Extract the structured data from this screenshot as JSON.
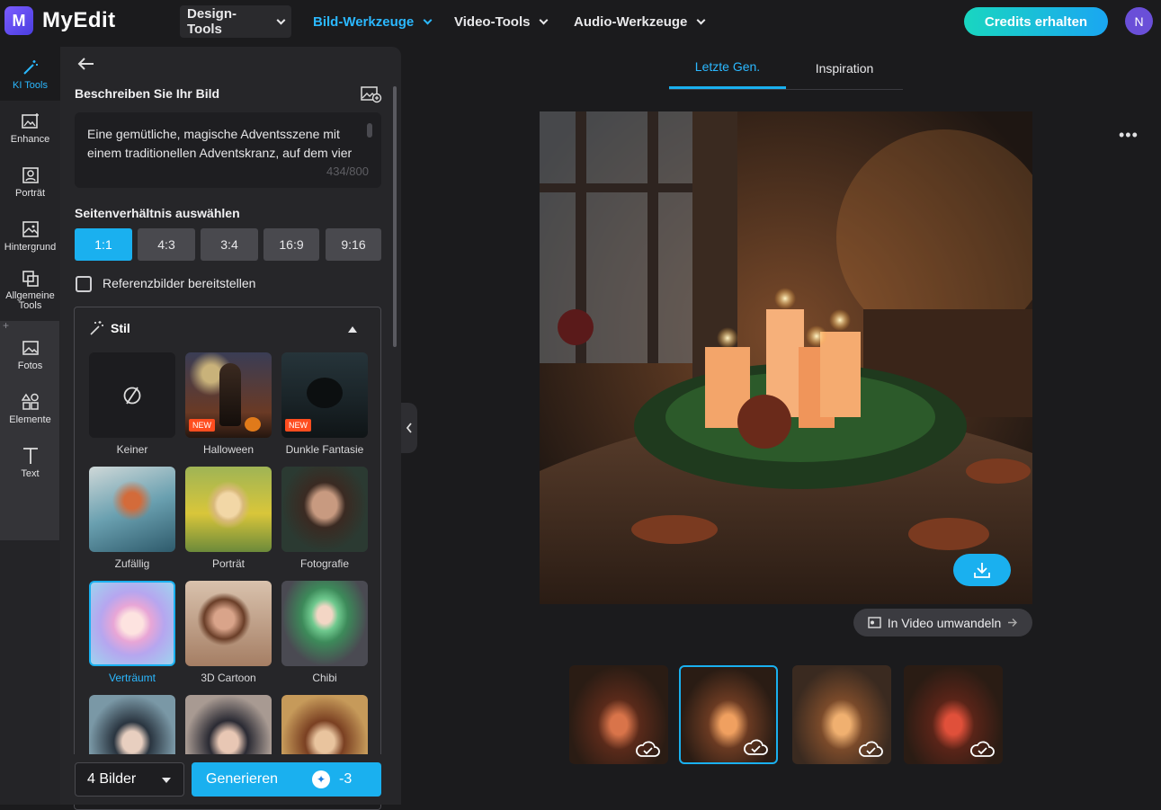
{
  "header": {
    "brand": "MyEdit",
    "nav": [
      {
        "label": "Design-Tools",
        "active": false
      },
      {
        "label": "Bild-Werkzeuge",
        "active": true
      },
      {
        "label": "Video-Tools",
        "active": false
      },
      {
        "label": "Audio-Werkzeuge",
        "active": false
      }
    ],
    "credits_label": "Credits erhalten",
    "avatar_initial": "N"
  },
  "rail": {
    "items": [
      {
        "label": "KI Tools",
        "icon": "magic-wand-icon"
      },
      {
        "label": "Enhance",
        "icon": "enhance-icon"
      },
      {
        "label": "Porträt",
        "icon": "portrait-icon"
      },
      {
        "label": "Hintergrund",
        "icon": "background-icon"
      },
      {
        "label": "Allgemeine Tools",
        "icon": "general-tools-icon"
      },
      {
        "label": "Fotos",
        "icon": "photos-icon"
      },
      {
        "label": "Elemente",
        "icon": "elements-icon"
      },
      {
        "label": "Text",
        "icon": "text-icon"
      }
    ]
  },
  "panel": {
    "describe_title": "Beschreiben Sie Ihr Bild",
    "prompt_text": "Eine gemütliche, magische Adventsszene mit einem traditionellen Adventskranz, auf dem vier",
    "char_count": "434/800",
    "ratio_title": "Seitenverhältnis auswählen",
    "ratios": [
      "1:1",
      "4:3",
      "3:4",
      "16:9",
      "9:16"
    ],
    "selected_ratio": "1:1",
    "reference_label": "Referenzbilder bereitstellen",
    "style_title": "Stil",
    "new_badge": "NEW",
    "styles": [
      {
        "label": "Keiner"
      },
      {
        "label": "Halloween"
      },
      {
        "label": "Dunkle Fantasie"
      },
      {
        "label": "Zufällig"
      },
      {
        "label": "Porträt"
      },
      {
        "label": "Fotografie"
      },
      {
        "label": "Verträumt"
      },
      {
        "label": "3D Cartoon"
      },
      {
        "label": "Chibi"
      }
    ],
    "image_count": "4 Bilder",
    "generate_label": "Generieren",
    "generate_cost": "-3"
  },
  "main": {
    "tabs": [
      "Letzte Gen.",
      "Inspiration"
    ],
    "active_tab": "Letzte Gen.",
    "to_video_label": "In Video umwandeln"
  },
  "colors": {
    "accent": "#1ab0ef",
    "brand": "#6a4fd8",
    "new_badge": "#ff4d1f"
  }
}
